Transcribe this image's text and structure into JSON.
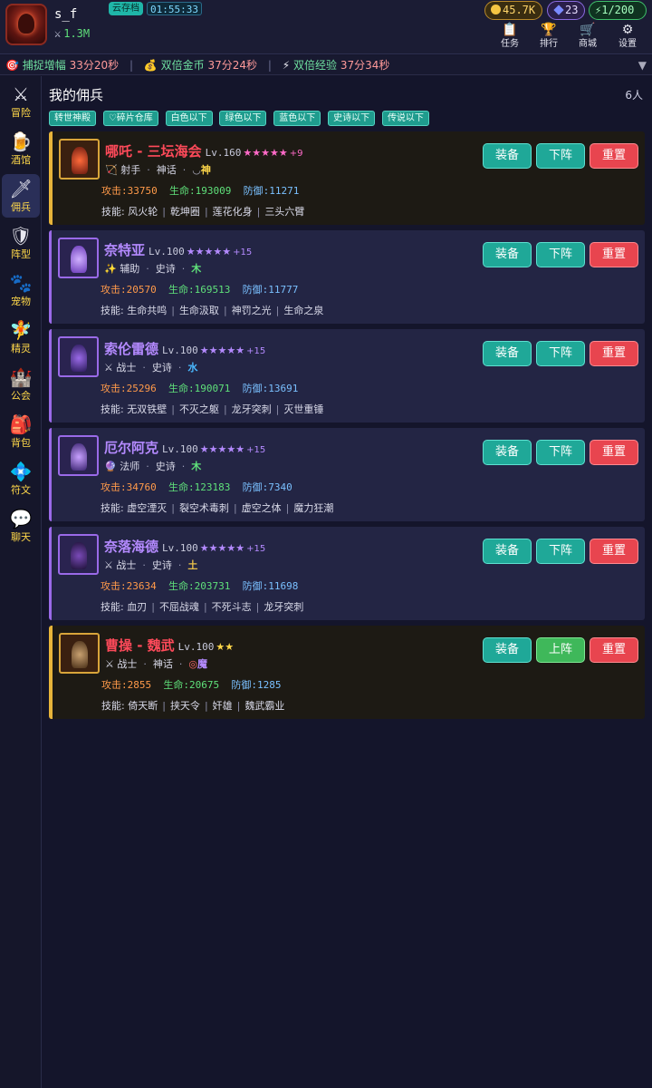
{
  "header": {
    "username": "s_f",
    "power_icon": "sword-icon",
    "power": "1.3M",
    "cloud_save": "云存档",
    "timer": "01:55:33",
    "gold": "45.7K",
    "gems": "23",
    "energy": "1/200",
    "menu": [
      {
        "label": "任务",
        "icon": "clipboard-icon"
      },
      {
        "label": "排行",
        "icon": "trophy-icon"
      },
      {
        "label": "商城",
        "icon": "cart-icon"
      },
      {
        "label": "设置",
        "icon": "settings-icon"
      }
    ]
  },
  "ticker": [
    {
      "icon": "target-icon",
      "label": "捕捉增幅",
      "value": "33分20秒"
    },
    {
      "icon": "money-bag-icon",
      "label": "双倍金币",
      "value": "37分24秒"
    },
    {
      "icon": "lightning-icon",
      "label": "双倍经验",
      "value": "37分34秒"
    }
  ],
  "sidebar": [
    {
      "label": "冒险",
      "icon": "crossed-swords-icon"
    },
    {
      "label": "酒馆",
      "icon": "beer-mug-icon"
    },
    {
      "label": "佣兵",
      "icon": "dagger-icon",
      "active": true
    },
    {
      "label": "阵型",
      "icon": "shield-icon"
    },
    {
      "label": "宠物",
      "icon": "paw-icon"
    },
    {
      "label": "精灵",
      "icon": "fairy-icon"
    },
    {
      "label": "公会",
      "icon": "castle-icon"
    },
    {
      "label": "背包",
      "icon": "backpack-icon"
    },
    {
      "label": "符文",
      "icon": "rune-icon"
    },
    {
      "label": "聊天",
      "icon": "chat-bubble-icon"
    }
  ],
  "page": {
    "title": "我的佣兵",
    "count": "6人",
    "filters": [
      "转世神殿",
      "♡碎片仓库",
      "白色以下",
      "绿色以下",
      "蓝色以下",
      "史诗以下",
      "传说以下"
    ]
  },
  "labels": {
    "atk": "攻击:",
    "hp": "生命:",
    "def": "防御:",
    "skills": "技能:",
    "equip": "装备",
    "deploy_down": "下阵",
    "deploy_up": "上阵",
    "reset": "重置"
  },
  "heroes": [
    {
      "name": "哪吒 - 三坛海会",
      "level": "Lv.160",
      "stars": "★★★★★",
      "plus": "+9",
      "class_icon": "bow-icon",
      "class": "射手",
      "rarity": "神话",
      "element_icon": "moon-icon",
      "element": "神",
      "element_color": "#ffd84a",
      "atk": "33750",
      "hp": "193009",
      "def": "11271",
      "skills": [
        "风火轮",
        "乾坤圈",
        "莲花化身",
        "三头六臂"
      ],
      "deployed": true
    },
    {
      "name": "奈特亚",
      "level": "Lv.100",
      "stars": "★★★★★",
      "plus": "+15",
      "class_icon": "sparkle-icon",
      "class": "辅助",
      "rarity": "史诗",
      "element_icon": "",
      "element": "木",
      "element_color": "#5fe07a",
      "atk": "20570",
      "hp": "169513",
      "def": "11777",
      "skills": [
        "生命共鸣",
        "生命汲取",
        "神罚之光",
        "生命之泉"
      ],
      "deployed": true
    },
    {
      "name": "索伦雷德",
      "level": "Lv.100",
      "stars": "★★★★★",
      "plus": "+15",
      "class_icon": "crossed-swords-icon",
      "class": "战士",
      "rarity": "史诗",
      "element_icon": "",
      "element": "水",
      "element_color": "#4ab8ff",
      "atk": "25296",
      "hp": "190071",
      "def": "13691",
      "skills": [
        "无双铁壁",
        "不灭之躯",
        "龙牙突刺",
        "灭世重锤"
      ],
      "deployed": true
    },
    {
      "name": "厄尔阿克",
      "level": "Lv.100",
      "stars": "★★★★★",
      "plus": "+15",
      "class_icon": "crystal-ball-icon",
      "class": "法师",
      "rarity": "史诗",
      "element_icon": "",
      "element": "木",
      "element_color": "#5fe07a",
      "atk": "34760",
      "hp": "123183",
      "def": "7340",
      "skills": [
        "虚空湮灭",
        "裂空术毒刺",
        "虚空之体",
        "魔力狂潮"
      ],
      "deployed": true
    },
    {
      "name": "奈落海德",
      "level": "Lv.100",
      "stars": "★★★★★",
      "plus": "+15",
      "class_icon": "crossed-swords-icon",
      "class": "战士",
      "rarity": "史诗",
      "element_icon": "",
      "element": "土",
      "element_color": "#e8c04a",
      "atk": "23634",
      "hp": "203731",
      "def": "11698",
      "skills": [
        "血刃",
        "不屈战魂",
        "不死斗志",
        "龙牙突刺"
      ],
      "deployed": true
    },
    {
      "name": "曹操 - 魏武",
      "level": "Lv.100",
      "stars": "★★",
      "plus": "",
      "class_icon": "crossed-swords-icon",
      "class": "战士",
      "rarity": "神话",
      "element_icon": "ring-icon",
      "element": "魔",
      "element_color": "#b48aff",
      "atk": "2855",
      "hp": "20675",
      "def": "1285",
      "skills": [
        "倚天断",
        "挟天令",
        "奸雄",
        "魏武霸业"
      ],
      "deployed": false
    }
  ]
}
